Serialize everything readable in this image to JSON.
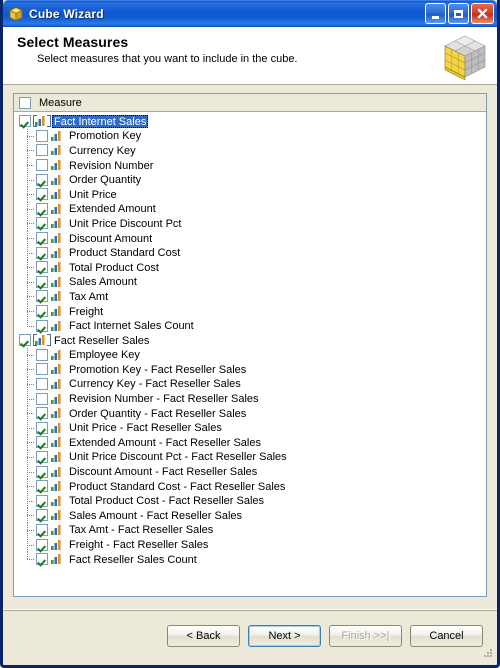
{
  "window": {
    "title": "Cube Wizard",
    "title_icon": "cube-icon",
    "caption": {
      "minimize": "minimize-button",
      "maximize": "maximize-button",
      "close": "close-button"
    },
    "frame_color": "#0a246a",
    "titlebar_color": "#1059d0"
  },
  "banner": {
    "heading": "Select Measures",
    "subheading": "Select measures that you want to include in the cube.",
    "image": "cube-graphic"
  },
  "tree": {
    "column_header": {
      "label": "Measure",
      "checked": false
    },
    "groups": [
      {
        "label": "Fact Internet Sales",
        "checked": true,
        "selected": true,
        "items": [
          {
            "label": "Promotion Key",
            "checked": false
          },
          {
            "label": "Currency Key",
            "checked": false
          },
          {
            "label": "Revision Number",
            "checked": false
          },
          {
            "label": "Order Quantity",
            "checked": true
          },
          {
            "label": "Unit Price",
            "checked": true
          },
          {
            "label": "Extended Amount",
            "checked": true
          },
          {
            "label": "Unit Price Discount Pct",
            "checked": true
          },
          {
            "label": "Discount Amount",
            "checked": true
          },
          {
            "label": "Product Standard Cost",
            "checked": true
          },
          {
            "label": "Total Product Cost",
            "checked": true
          },
          {
            "label": "Sales Amount",
            "checked": true
          },
          {
            "label": "Tax Amt",
            "checked": true
          },
          {
            "label": "Freight",
            "checked": true
          },
          {
            "label": "Fact Internet Sales Count",
            "checked": true
          }
        ]
      },
      {
        "label": "Fact Reseller Sales",
        "checked": true,
        "selected": false,
        "items": [
          {
            "label": "Employee Key",
            "checked": false
          },
          {
            "label": "Promotion Key - Fact Reseller Sales",
            "checked": false
          },
          {
            "label": "Currency Key - Fact Reseller Sales",
            "checked": false
          },
          {
            "label": "Revision Number - Fact Reseller Sales",
            "checked": false
          },
          {
            "label": "Order Quantity - Fact Reseller Sales",
            "checked": true
          },
          {
            "label": "Unit Price - Fact Reseller Sales",
            "checked": true
          },
          {
            "label": "Extended Amount - Fact Reseller Sales",
            "checked": true
          },
          {
            "label": "Unit Price Discount Pct - Fact Reseller Sales",
            "checked": true
          },
          {
            "label": "Discount Amount - Fact Reseller Sales",
            "checked": true
          },
          {
            "label": "Product Standard Cost - Fact Reseller Sales",
            "checked": true
          },
          {
            "label": "Total Product Cost - Fact Reseller Sales",
            "checked": true
          },
          {
            "label": "Sales Amount - Fact Reseller Sales",
            "checked": true
          },
          {
            "label": "Tax Amt - Fact Reseller Sales",
            "checked": true
          },
          {
            "label": "Freight - Fact Reseller Sales",
            "checked": true
          },
          {
            "label": "Fact Reseller Sales Count",
            "checked": true
          }
        ]
      }
    ]
  },
  "footer": {
    "buttons": [
      {
        "label": "< Back",
        "name": "back-button",
        "state": "enabled"
      },
      {
        "label": "Next >",
        "name": "next-button",
        "state": "default"
      },
      {
        "label": "Finish >>|",
        "name": "finish-button",
        "state": "disabled"
      },
      {
        "label": "Cancel",
        "name": "cancel-button",
        "state": "enabled"
      }
    ]
  }
}
